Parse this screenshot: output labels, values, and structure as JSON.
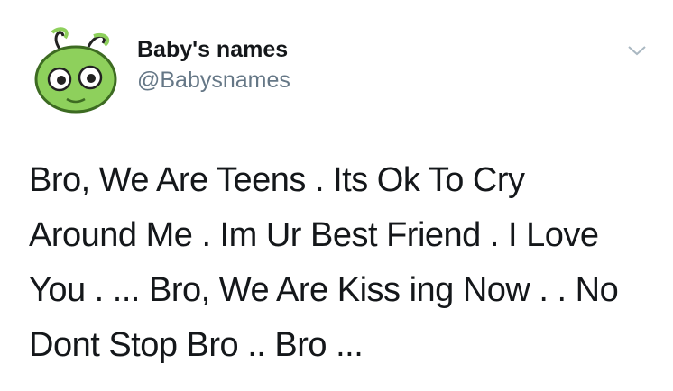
{
  "tweet": {
    "author": {
      "display_name": "Baby's names",
      "handle": "@Babysnames",
      "avatar_icon": "green-alien-avatar-icon"
    },
    "menu_icon": "chevron-down-icon",
    "text_lines": [
      "Bro, We Are Teens . Its Ok To Cry",
      "Around Me . Im Ur Best Friend . I Love",
      "You . ... Bro, We Are Kiss ing Now . . No",
      "Dont Stop Bro .. Bro ..."
    ]
  },
  "colors": {
    "text": "#14171a",
    "secondary_text": "#657786",
    "avatar_green": "#8ed05c",
    "chevron": "#aab8c2"
  }
}
